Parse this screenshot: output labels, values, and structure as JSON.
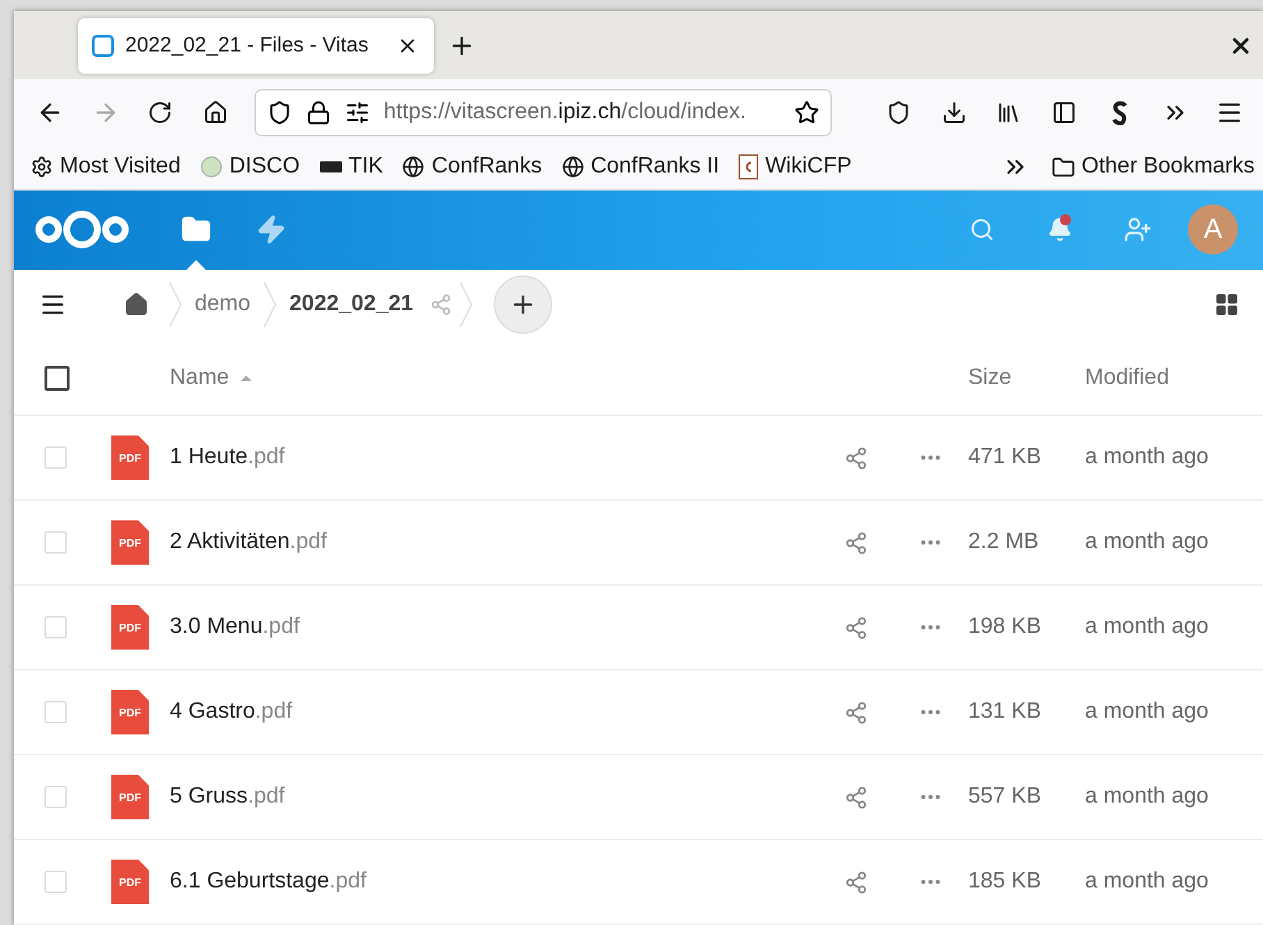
{
  "browser": {
    "tab": {
      "title": "2022_02_21 - Files - Vitas",
      "selected": true
    },
    "url": {
      "before": "https://vitascreen.",
      "domain": "ipiz.ch",
      "after": "/cloud/index."
    },
    "bookmarks": [
      {
        "label": "Most Visited",
        "kind": "gear"
      },
      {
        "label": "DISCO",
        "kind": "sphere"
      },
      {
        "label": "TIK",
        "kind": "logo"
      },
      {
        "label": "ConfRanks",
        "kind": "globe"
      },
      {
        "label": "ConfRanks II",
        "kind": "globe"
      },
      {
        "label": "WikiCFP",
        "kind": "letter"
      }
    ],
    "other_bookmarks": "Other Bookmarks"
  },
  "app": {
    "nav": [
      {
        "kind": "files",
        "selected": true
      },
      {
        "kind": "activity",
        "selected": false
      }
    ],
    "notifications_unread": true,
    "avatar": "A"
  },
  "breadcrumb": [
    {
      "label": "demo",
      "current": false
    },
    {
      "label": "2022_02_21",
      "current": true
    }
  ],
  "table": {
    "columns": [
      "Name",
      "Size",
      "Modified"
    ],
    "sort_ascending": true,
    "all_checked": false,
    "rows": [
      {
        "name": "1 Heute",
        "extension": ".pdf",
        "icon_label": "PDF",
        "size": "471 KB",
        "modified": "a month ago",
        "selected": false
      },
      {
        "name": "2 Aktivitäten",
        "extension": ".pdf",
        "icon_label": "PDF",
        "size": "2.2 MB",
        "modified": "a month ago",
        "selected": false
      },
      {
        "name": "3.0 Menu",
        "extension": ".pdf",
        "icon_label": "PDF",
        "size": "198 KB",
        "modified": "a month ago",
        "selected": false
      },
      {
        "name": "4 Gastro",
        "extension": ".pdf",
        "icon_label": "PDF",
        "size": "131 KB",
        "modified": "a month ago",
        "selected": false
      },
      {
        "name": "5 Gruss",
        "extension": ".pdf",
        "icon_label": "PDF",
        "size": "557 KB",
        "modified": "a month ago",
        "selected": false
      },
      {
        "name": "6.1 Geburtstage",
        "extension": ".pdf",
        "icon_label": "PDF",
        "size": "185 KB",
        "modified": "a month ago",
        "selected": false
      }
    ]
  }
}
